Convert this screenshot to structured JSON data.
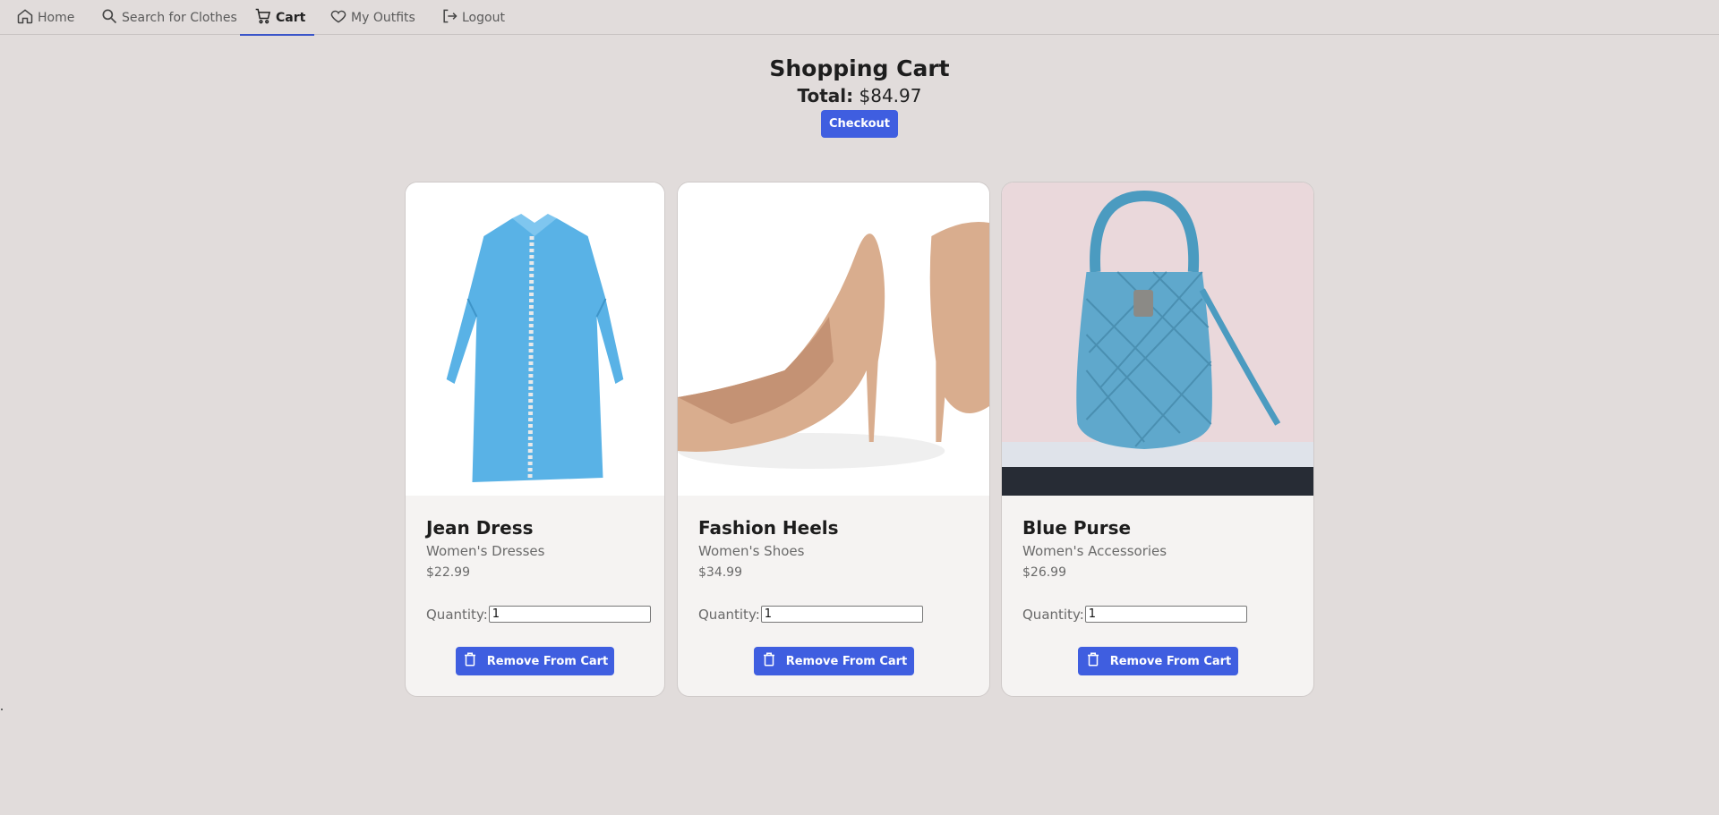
{
  "nav": {
    "items": [
      {
        "label": "Home",
        "icon": "home-icon"
      },
      {
        "label": "Search for Clothes",
        "icon": "search-icon"
      },
      {
        "label": "Cart",
        "icon": "cart-icon",
        "active": true
      },
      {
        "label": "My Outfits",
        "icon": "heart-icon"
      },
      {
        "label": "Logout",
        "icon": "logout-icon"
      }
    ]
  },
  "cart": {
    "title": "Shopping Cart",
    "total_label": "Total:",
    "total_value": "$84.97",
    "checkout_label": "Checkout"
  },
  "items": [
    {
      "name": "Jean Dress",
      "category": "Women's Dresses",
      "price": "$22.99",
      "quantity_label": "Quantity:",
      "quantity": "1",
      "remove_label": "Remove From Cart"
    },
    {
      "name": "Fashion Heels",
      "category": "Women's Shoes",
      "price": "$34.99",
      "quantity_label": "Quantity:",
      "quantity": "1",
      "remove_label": "Remove From Cart"
    },
    {
      "name": "Blue Purse",
      "category": "Women's Accessories",
      "price": "$26.99",
      "quantity_label": "Quantity:",
      "quantity": "1",
      "remove_label": "Remove From Cart"
    }
  ],
  "colors": {
    "accent": "#3f5ee0",
    "background": "#e1dcdb",
    "card": "#f5f3f2"
  }
}
